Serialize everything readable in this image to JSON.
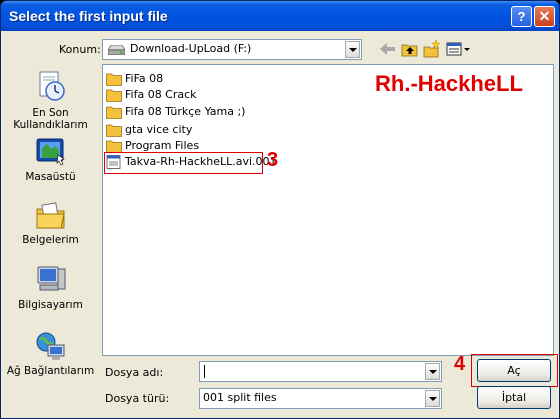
{
  "window": {
    "title": "Select the first input file",
    "help": "?",
    "close": "✕"
  },
  "lookin": {
    "label": "Konum:",
    "value": "Download-UpLoad (F:)"
  },
  "toolbar": {
    "back": "back-icon",
    "up": "folder-up-icon",
    "newfolder": "new-folder-icon",
    "views": "views-icon"
  },
  "places": [
    {
      "label": "En Son\nKullandıklarım",
      "icon": "recent-documents-icon"
    },
    {
      "label": "Masaüstü",
      "icon": "desktop-icon"
    },
    {
      "label": "Belgelerim",
      "icon": "my-documents-icon"
    },
    {
      "label": "Bilgisayarım",
      "icon": "my-computer-icon"
    },
    {
      "label": "Ağ Bağlantılarım",
      "icon": "network-places-icon"
    }
  ],
  "files": [
    {
      "name": "FiFa 08",
      "type": "folder"
    },
    {
      "name": "Fifa 08 Crack",
      "type": "folder"
    },
    {
      "name": "Fifa 08 Türkçe Yama ;)",
      "type": "folder"
    },
    {
      "name": "gta vice city",
      "type": "folder"
    },
    {
      "name": "Program Files",
      "type": "folder"
    },
    {
      "name": "Takva-Rh-HackheLL.avi.001",
      "type": "file"
    }
  ],
  "annotations": {
    "brand": "Rh.-HackheLL",
    "step3": "3",
    "step4": "4"
  },
  "filename": {
    "label": "Dosya adı:",
    "value": ""
  },
  "filetype": {
    "label": "Dosya türü:",
    "value": "001 split files"
  },
  "buttons": {
    "open": "Aç",
    "cancel": "İptal"
  },
  "colors": {
    "title_blue": "#0054e3",
    "annotation_red": "#e00000",
    "folder_yellow": "#f3c23c"
  }
}
